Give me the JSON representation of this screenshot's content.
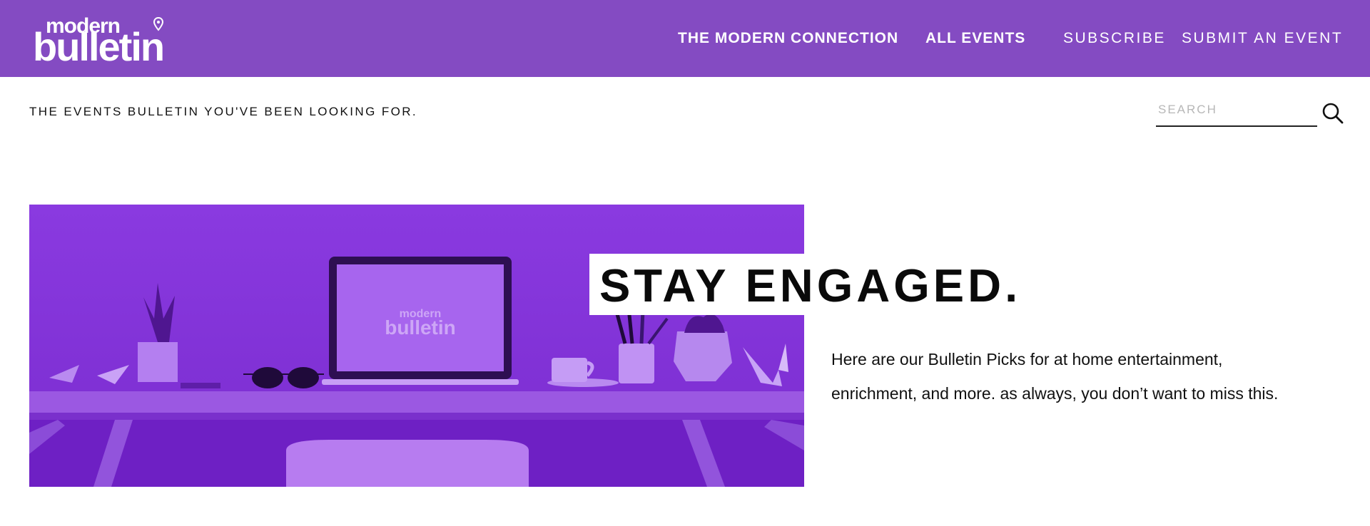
{
  "header": {
    "logo": {
      "line1": "modern",
      "line2": "bulletin"
    },
    "nav": [
      {
        "label": "THE MODERN CONNECTION"
      },
      {
        "label": "ALL EVENTS"
      },
      {
        "label": "SUBSCRIBE"
      },
      {
        "label": "SUBMIT AN EVENT"
      }
    ]
  },
  "subheader": {
    "tagline": "THE EVENTS BULLETIN YOU'VE BEEN LOOKING FOR.",
    "search": {
      "placeholder": "SEARCH",
      "value": ""
    },
    "search_icon": "search-icon"
  },
  "hero": {
    "image_alt": "Desk with laptop, plants, sunglasses, cup and origami birds",
    "screen_logo": {
      "line1": "modern",
      "line2": "bulletin"
    }
  },
  "main": {
    "headline": "STAY ENGAGED.",
    "body": "Here are our Bulletin Picks for at home entertainment, enrichment, and more. as always, you don’t want to miss this."
  },
  "colors": {
    "brand_purple": "#844bc2",
    "hero_purple": "#7f2fd6",
    "text": "#111111"
  }
}
